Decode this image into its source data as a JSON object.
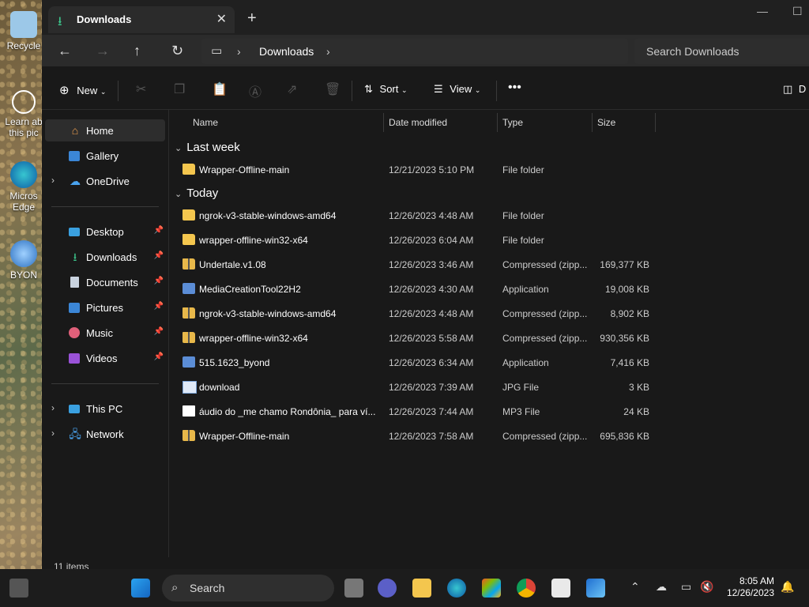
{
  "desktop": {
    "icons": [
      {
        "label": "Recycle"
      },
      {
        "label": "Learn ab this pic"
      },
      {
        "label": "Micros Edge"
      },
      {
        "label": "BYON"
      }
    ]
  },
  "window": {
    "tab_title": "Downloads",
    "address": {
      "crumb": "Downloads"
    },
    "search_placeholder": "Search Downloads",
    "toolbar": {
      "new_label": "New",
      "sort_label": "Sort",
      "view_label": "View",
      "details_label": "D"
    }
  },
  "nav": {
    "items": [
      {
        "label": "Home"
      },
      {
        "label": "Gallery"
      },
      {
        "label": "OneDrive"
      },
      {
        "label": "Desktop"
      },
      {
        "label": "Downloads"
      },
      {
        "label": "Documents"
      },
      {
        "label": "Pictures"
      },
      {
        "label": "Music"
      },
      {
        "label": "Videos"
      },
      {
        "label": "This PC"
      },
      {
        "label": "Network"
      }
    ]
  },
  "columns": {
    "name": "Name",
    "date": "Date modified",
    "type": "Type",
    "size": "Size"
  },
  "groups": {
    "last_week": {
      "label": "Last week",
      "files": [
        {
          "name": "Wrapper-Offline-main",
          "date": "12/21/2023 5:10 PM",
          "type": "File folder",
          "size": "",
          "icon": "folder"
        }
      ]
    },
    "today": {
      "label": "Today",
      "files": [
        {
          "name": "ngrok-v3-stable-windows-amd64",
          "date": "12/26/2023 4:48 AM",
          "type": "File folder",
          "size": "",
          "icon": "folder"
        },
        {
          "name": "wrapper-offline-win32-x64",
          "date": "12/26/2023 6:04 AM",
          "type": "File folder",
          "size": "",
          "icon": "folder"
        },
        {
          "name": "Undertale.v1.08",
          "date": "12/26/2023 3:46 AM",
          "type": "Compressed (zipp...",
          "size": "169,377 KB",
          "icon": "zip"
        },
        {
          "name": "MediaCreationTool22H2",
          "date": "12/26/2023 4:30 AM",
          "type": "Application",
          "size": "19,008 KB",
          "icon": "app"
        },
        {
          "name": "ngrok-v3-stable-windows-amd64",
          "date": "12/26/2023 4:48 AM",
          "type": "Compressed (zipp...",
          "size": "8,902 KB",
          "icon": "zip"
        },
        {
          "name": "wrapper-offline-win32-x64",
          "date": "12/26/2023 5:58 AM",
          "type": "Compressed (zipp...",
          "size": "930,356 KB",
          "icon": "zip"
        },
        {
          "name": "515.1623_byond",
          "date": "12/26/2023 6:34 AM",
          "type": "Application",
          "size": "7,416 KB",
          "icon": "app"
        },
        {
          "name": "download",
          "date": "12/26/2023 7:39 AM",
          "type": "JPG File",
          "size": "3 KB",
          "icon": "jpg"
        },
        {
          "name": "áudio do _me chamo Rondônia_ para ví...",
          "date": "12/26/2023 7:44 AM",
          "type": "MP3 File",
          "size": "24 KB",
          "icon": "doc"
        },
        {
          "name": "Wrapper-Offline-main",
          "date": "12/26/2023 7:58 AM",
          "type": "Compressed (zipp...",
          "size": "695,836 KB",
          "icon": "zip"
        }
      ]
    }
  },
  "status": "11 items",
  "taskbar": {
    "search_label": "Search",
    "time": "8:05 AM",
    "date": "12/26/2023"
  }
}
